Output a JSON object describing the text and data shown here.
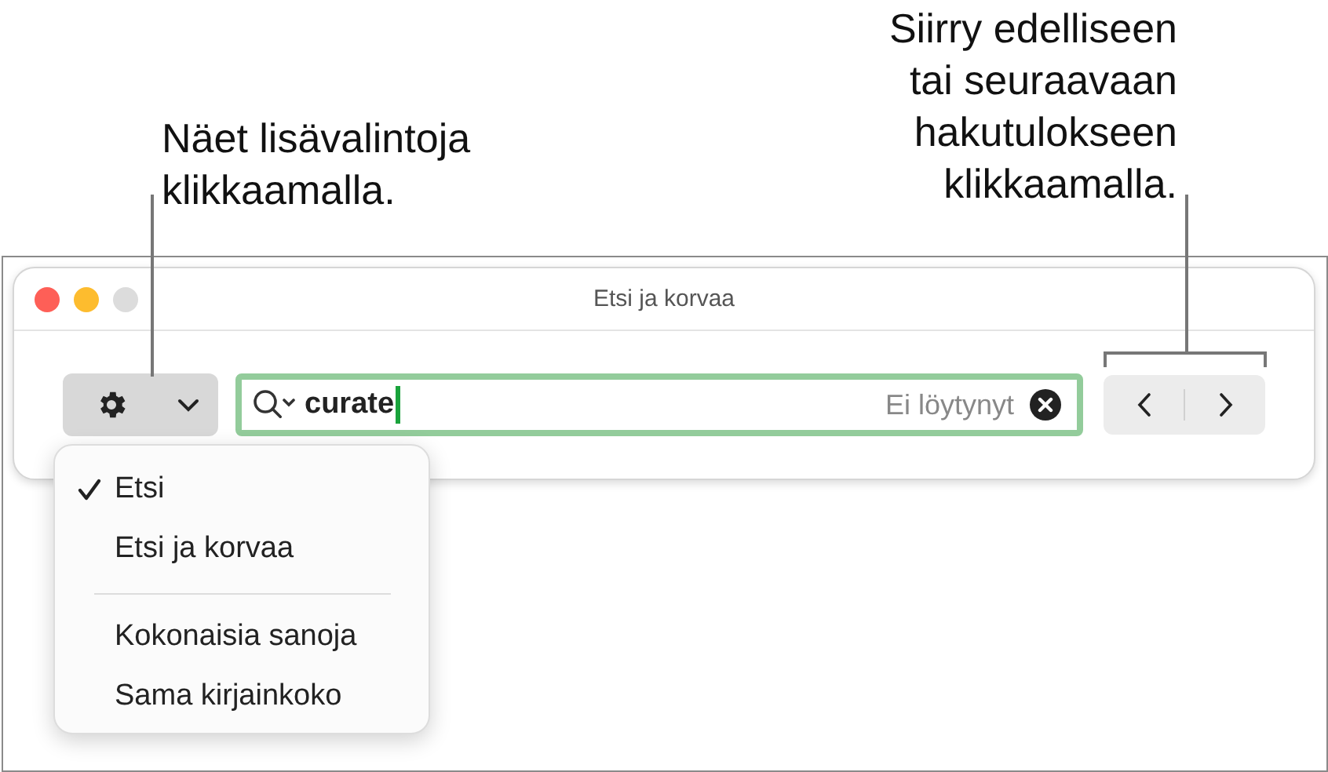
{
  "callouts": [
    {
      "lines": [
        "Näet lisävalintoja",
        "klikkaamalla."
      ]
    },
    {
      "lines": [
        "Siirry edelliseen",
        "tai seuraavaan",
        "hakutulokseen",
        "klikkaamalla."
      ]
    }
  ],
  "window": {
    "title": "Etsi ja korvaa"
  },
  "search": {
    "value": "curate",
    "status": "Ei löytynyt"
  },
  "menu": [
    {
      "kind": "option",
      "label": "Etsi",
      "checked": true
    },
    {
      "kind": "option",
      "label": "Etsi ja korvaa",
      "checked": false
    },
    {
      "kind": "separator"
    },
    {
      "kind": "option",
      "label": "Kokonaisia sanoja",
      "checked": false
    },
    {
      "kind": "option",
      "label": "Sama kirjainkoko",
      "checked": false
    }
  ]
}
